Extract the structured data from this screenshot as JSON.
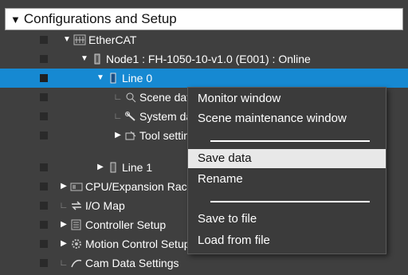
{
  "header": {
    "arrow": "▼",
    "title": "Configurations and Setup"
  },
  "tree": [
    {
      "label": "EtherCAT",
      "icon": "ethercat-icon"
    },
    {
      "label": "Node1 : FH-1050-10-v1.0 (E001) : Online",
      "icon": "node-device-icon"
    },
    {
      "label": "Line 0",
      "icon": "line-icon"
    },
    {
      "label": "Scene data",
      "icon": "scene-icon"
    },
    {
      "label": "System data",
      "icon": "wrench-icon"
    },
    {
      "label": "Tool settings",
      "icon": "tool-icon"
    },
    {
      "label": "Line 1",
      "icon": "line-icon"
    },
    {
      "label": "CPU/Expansion Racks",
      "icon": "cpu-rack-icon"
    },
    {
      "label": "I/O Map",
      "icon": "io-map-icon"
    },
    {
      "label": "Controller Setup",
      "icon": "controller-setup-icon"
    },
    {
      "label": "Motion Control Setup",
      "icon": "motion-control-icon"
    },
    {
      "label": "Cam Data Settings",
      "icon": "cam-data-icon"
    }
  ],
  "context_menu": {
    "items": [
      {
        "label": "Monitor window"
      },
      {
        "label": "Scene maintenance window"
      },
      {
        "label": "Save data"
      },
      {
        "label": "Rename"
      },
      {
        "label": "Save to file"
      },
      {
        "label": "Load from file"
      }
    ],
    "active_index": 2
  },
  "colors": {
    "background": "#3f3f3f",
    "selection": "#1689d2",
    "menu_highlight": "#e8e8e8"
  }
}
